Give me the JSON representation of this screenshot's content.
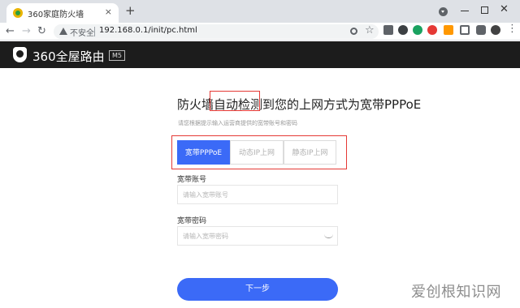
{
  "browser": {
    "tab_title": "360家庭防火墙",
    "tab_close": "×",
    "new_tab": "+",
    "insecure_label": "不安全",
    "url": "192.168.0.1/init/pc.html"
  },
  "header": {
    "brand": "360全屋路由",
    "model": "M5"
  },
  "main": {
    "heading": "防火墙自动检测到您的上网方式为宽带PPPoE",
    "subtitle": "请您根据提示输入运营商提供的宽带账号和密码",
    "tabs": [
      {
        "label": "宽带PPPoE",
        "active": true
      },
      {
        "label": "动态IP上网",
        "active": false
      },
      {
        "label": "静态IP上网",
        "active": false
      }
    ],
    "account": {
      "label": "宽带账号",
      "placeholder": "请输入宽带账号",
      "value": ""
    },
    "password": {
      "label": "宽带密码",
      "placeholder": "请输入宽带密码",
      "value": ""
    },
    "next_label": "下一步"
  },
  "watermark": "爱创根知识网",
  "colors": {
    "accent": "#3b6af7",
    "highlight_box": "#e53935",
    "header_bg": "#1c1c1c"
  }
}
